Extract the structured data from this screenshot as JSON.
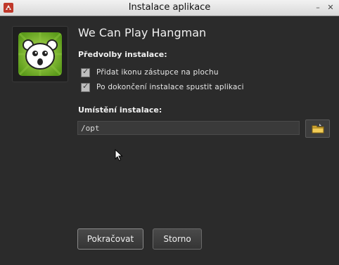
{
  "window": {
    "title": "Instalace aplikace",
    "minimize_glyph": "–",
    "close_glyph": "✕"
  },
  "app": {
    "name": "We Can Play Hangman",
    "icon": "hangman-face-icon"
  },
  "preferences": {
    "label": "Předvolby instalace:",
    "options": [
      {
        "label": "Přidat ikonu zástupce na plochu",
        "checked": true
      },
      {
        "label": "Po dokončení instalace spustit aplikaci",
        "checked": true
      }
    ]
  },
  "location": {
    "label": "Umístění instalace:",
    "value": "/opt",
    "browse_icon": "folder-icon"
  },
  "buttons": {
    "continue": "Pokračovat",
    "cancel": "Storno"
  },
  "colors": {
    "background": "#2b2b2b",
    "icon_green": "#7ab827",
    "text": "#f0f0f0"
  }
}
